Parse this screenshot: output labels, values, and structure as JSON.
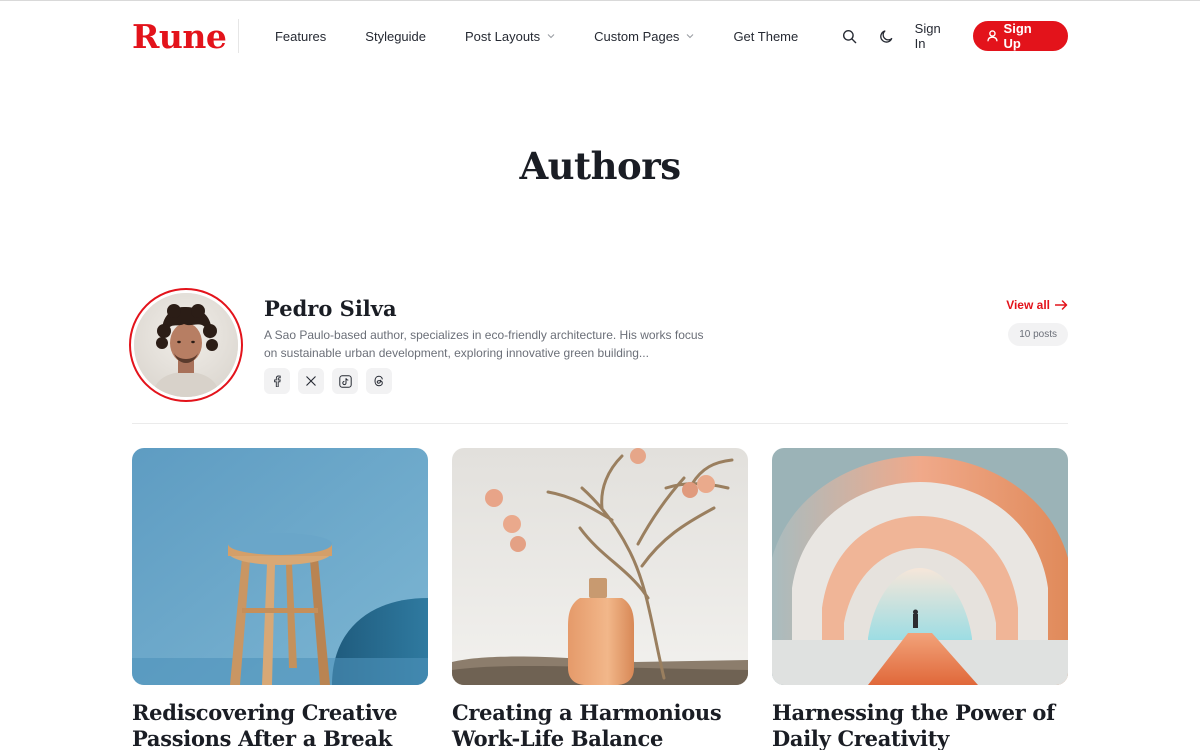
{
  "header": {
    "logo": "Rune",
    "nav": [
      {
        "label": "Features",
        "dropdown": false
      },
      {
        "label": "Styleguide",
        "dropdown": false
      },
      {
        "label": "Post Layouts",
        "dropdown": true
      },
      {
        "label": "Custom Pages",
        "dropdown": true
      },
      {
        "label": "Get Theme",
        "dropdown": false
      }
    ],
    "signin_label": "Sign In",
    "signup_label": "Sign Up",
    "icons": [
      "search-icon",
      "moon-icon",
      "user-icon"
    ]
  },
  "page": {
    "title": "Authors"
  },
  "author": {
    "name": "Pedro Silva",
    "bio": "A Sao Paulo-based author, specializes in eco-friendly architecture. His works focus on sustainable urban development, exploring innovative green building...",
    "socials": [
      "facebook-icon",
      "x-icon",
      "tiktok-icon",
      "threads-icon"
    ],
    "view_all_label": "View all",
    "posts_count": "10 posts"
  },
  "posts": [
    {
      "title": "Rediscovering Creative Passions After a Break",
      "image": "wooden-stool-on-blue"
    },
    {
      "title": "Creating a Harmonious Work-Life Balance",
      "image": "vase-with-blossom-branch"
    },
    {
      "title": "Harnessing the Power of Daily Creativity",
      "image": "orange-arched-corridor"
    }
  ],
  "colors": {
    "accent": "#e3131b",
    "text": "#1a1d24",
    "muted": "#6b6f78"
  }
}
